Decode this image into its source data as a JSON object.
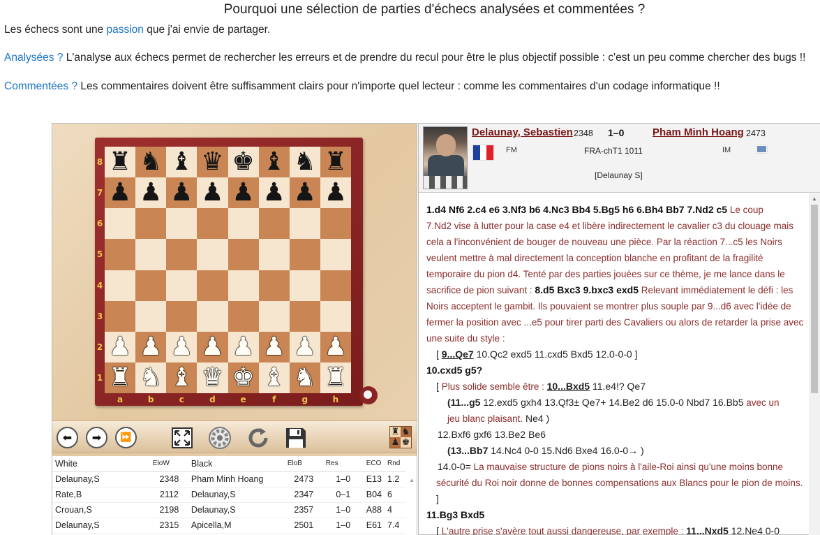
{
  "heading": "Pourquoi une sélection de parties d'échecs analysées et commentées ?",
  "intro": {
    "p1_before": "Les échecs sont une ",
    "p1_link": "passion",
    "p1_after": " que j'ai envie de partager.",
    "p2_link": "Analysées ?",
    "p2_text": " L'analyse aux échecs permet de rechercher les erreurs et de prendre du recul pour être le plus objectif possible : c'est un peu comme chercher des bugs !!",
    "p3_link": "Commentées ?",
    "p3_text": " Les commentaires doivent être suffisamment clairs pour n'importe quel lecteur : comme les commentaires d'un codage informatique !!"
  },
  "board": {
    "ranks": [
      "8",
      "7",
      "6",
      "5",
      "4",
      "3",
      "2",
      "1"
    ],
    "files": [
      "a",
      "b",
      "c",
      "d",
      "e",
      "f",
      "g",
      "h"
    ],
    "position": [
      [
        "bR",
        "bN",
        "bB",
        "bQ",
        "bK",
        "bB",
        "bN",
        "bR"
      ],
      [
        "bP",
        "bP",
        "bP",
        "bP",
        "bP",
        "bP",
        "bP",
        "bP"
      ],
      [
        "",
        "",
        "",
        "",
        "",
        "",
        "",
        ""
      ],
      [
        "",
        "",
        "",
        "",
        "",
        "",
        "",
        ""
      ],
      [
        "",
        "",
        "",
        "",
        "",
        "",
        "",
        ""
      ],
      [
        "",
        "",
        "",
        "",
        "",
        "",
        "",
        ""
      ],
      [
        "wP",
        "wP",
        "wP",
        "wP",
        "wP",
        "wP",
        "wP",
        "wP"
      ],
      [
        "wR",
        "wN",
        "wB",
        "wQ",
        "wK",
        "wB",
        "wN",
        "wR"
      ]
    ],
    "light_color": "#f6e6cf",
    "dark_color": "#c98654",
    "frame_color": "#8e2626",
    "coord_color": "#f0c44a"
  },
  "toolbar": {
    "icons": [
      "arrow-left-icon",
      "arrow-right-icon",
      "fast-forward-icon",
      "fullscreen-icon",
      "autoplay-wheel-icon",
      "flip-board-icon",
      "save-icon",
      "piece-set-icon"
    ]
  },
  "games": {
    "columns": [
      "White",
      "EloW",
      "Black",
      "EloB",
      "Res",
      "ECO",
      "Rnd"
    ],
    "rows": [
      [
        "Delaunay,S",
        "2348",
        "Pham Minh Hoang",
        "2473",
        "1–0",
        "E13",
        "1.2"
      ],
      [
        "Rate,B",
        "2112",
        "Delaunay,S",
        "2347",
        "0–1",
        "B04",
        "6"
      ],
      [
        "Crouan,S",
        "2198",
        "Delaunay,S",
        "2357",
        "1–0",
        "A88",
        "4"
      ],
      [
        "Delaunay,S",
        "2315",
        "Apicella,M",
        "2501",
        "1–0",
        "E61",
        "7.4"
      ]
    ]
  },
  "header": {
    "white_name": "Delaunay, Sebastien",
    "white_elo": "2348",
    "result": "1–0",
    "black_name": "Pham Minh Hoang",
    "black_elo": "2473",
    "white_title": "FM",
    "event": "FRA-chT1 1011",
    "black_title": "IM",
    "annotator": "[Delaunay S]"
  },
  "moves": {
    "l1_moves": "1.d4 Nf6 2.c4 e6 3.Nf3 b6 4.Nc3 Bb4 5.Bg5 h6 6.Bh4 Bb7 7.Nd2 c5",
    "l1_comment": " Le coup",
    "c2": "7.Nd2 vise à lutter pour la case e4 et libère indirectement le cavalier c3 du clouage mais",
    "c3": "cela a l'inconvénient de bouger de nouveau une pièce. Par la réaction 7...c5 les Noirs",
    "c4": "veulent mettre à mal directement la conception blanche en profitant de la fragilité",
    "c5": "temporaire du pion d4. Tenté par des parties jouées sur ce thème, je me lance dans le",
    "c6_comment": "sacrifice de pion suivant : ",
    "c6_moves": "8.d5 Bxc3 9.bxc3 exd5",
    "c6_comment2": " Relevant immédiatement le défi : les",
    "c7": "Noirs acceptent le gambit. Ils pouvaient se montrer plus souple par 9...d6 avec l'idée de",
    "c8": "fermer la position avec ...e5 pour tirer parti des Cavaliers ou alors de retarder la prise avec",
    "c9": "une suite du style :",
    "v1_open": "[ ",
    "v1_bold": "9...Qe7",
    "v1_rest": " 10.Qc2 exd5 11.cxd5 Bxd5 12.0-0-0 ]",
    "m10": "10.cxd5 g5?",
    "v2_open": "[ ",
    "v2_comment": "Plus solide semble être : ",
    "v2_bold": "10...Bxd5",
    "v2_rest": " 11.e4!? Qe7",
    "v3_bold": "(11...g5",
    "v3_rest": " 12.exd5 gxh4 13.Qf3± Qe7+ 14.Be2 d6 15.0-0 Nbd7 16.Bb5",
    "v3_comment": " avec un",
    "v4_comment": "jeu blanc plaisant.",
    "v4_rest": "  Ne4 )",
    "v5": "12.Bxf6 gxf6 13.Be2 Be6",
    "v6_bold": "(13...Bb7",
    "v6_rest": " 14.Nc4 0-0 15.Nd6 Bxe4 16.0-0→ )",
    "v7_moves": "14.0-0=",
    "v7_comment": " La mauvaise structure de pions noirs à l'aile-Roi ainsi qu'une moins bonne",
    "v8_comment": "sécurité du Roi noir donne de bonnes compensations aux Blancs pour le pion de moins.",
    "v9": "]",
    "m11": "11.Bg3 Bxd5",
    "v10_open": "[ ",
    "v10_comment": "L'autre prise s'avère tout aussi dangereuse, par exemple : ",
    "v10_bold": "11...Nxd5",
    "v10_rest": " 12.Ne4 0-0"
  }
}
